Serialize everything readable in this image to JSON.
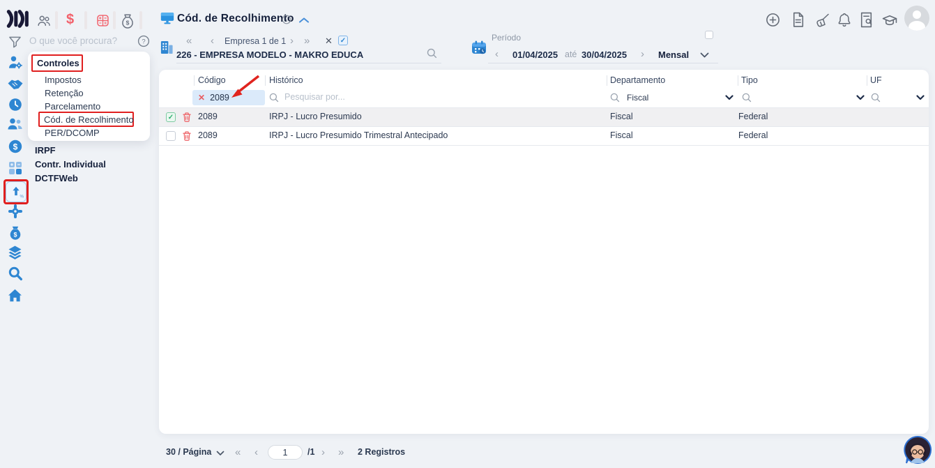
{
  "colors": {
    "accent_blue": "#2e86d2",
    "icon_red": "#f2616b",
    "annotation_red": "#e01f1f",
    "filter_chip_bg": "#dbeafa",
    "row_highlight": "#f0f0f2"
  },
  "topbar": {
    "left_icons": [
      "users-icon",
      "dollar-icon",
      "calculator-icon",
      "money-bag-icon"
    ],
    "right_icons": [
      "plus-circle-icon",
      "file-icon",
      "broom-icon",
      "bell-icon",
      "file-search-icon",
      "graduation-cap-icon",
      "user-avatar"
    ]
  },
  "sidebar": {
    "search_placeholder": "O que você procura?",
    "menu": {
      "section": "Controles",
      "items": [
        "Impostos",
        "Retenção",
        "Parcelamento",
        "Cód. de Recolhimento",
        "PER/DCOMP"
      ]
    },
    "bold_items": [
      "IRPF",
      "Contr. Individual",
      "DCTFWeb"
    ],
    "rail_icons": [
      "person-gear-icon",
      "handshake-icon",
      "clock-icon",
      "users-icon",
      "dollar-circle-icon",
      "calculator-grid-icon",
      "arrow-up-percent-icon",
      "gear-icon",
      "money-bag-icon",
      "layers-icon",
      "search-icon",
      "home-icon"
    ]
  },
  "header": {
    "title": "Cód. de Recolhimento"
  },
  "company_nav": {
    "position_label": "Empresa 1 de 1",
    "company": "226 - EMPRESA MODELO - MAKRO EDUCA",
    "checked": true
  },
  "period": {
    "label": "Período",
    "start": "01/04/2025",
    "until_label": "até",
    "end": "30/04/2025",
    "mode": "Mensal",
    "checked": false
  },
  "table": {
    "columns": [
      "Código",
      "Histórico",
      "Departamento",
      "Tipo",
      "UF"
    ],
    "filters": {
      "codigo_value": "2089",
      "historico_placeholder": "Pesquisar por...",
      "departamento_value": "Fiscal"
    },
    "rows": [
      {
        "checked": true,
        "codigo": "2089",
        "historico": "IRPJ - Lucro Presumido",
        "departamento": "Fiscal",
        "tipo": "Federal",
        "uf": ""
      },
      {
        "checked": false,
        "codigo": "2089",
        "historico": "IRPJ - Lucro Presumido Trimestral Antecipado",
        "departamento": "Fiscal",
        "tipo": "Federal",
        "uf": ""
      }
    ]
  },
  "pagination": {
    "per_page": "30 / Página",
    "page": "1",
    "total": "/1",
    "records": "2 Registros"
  }
}
